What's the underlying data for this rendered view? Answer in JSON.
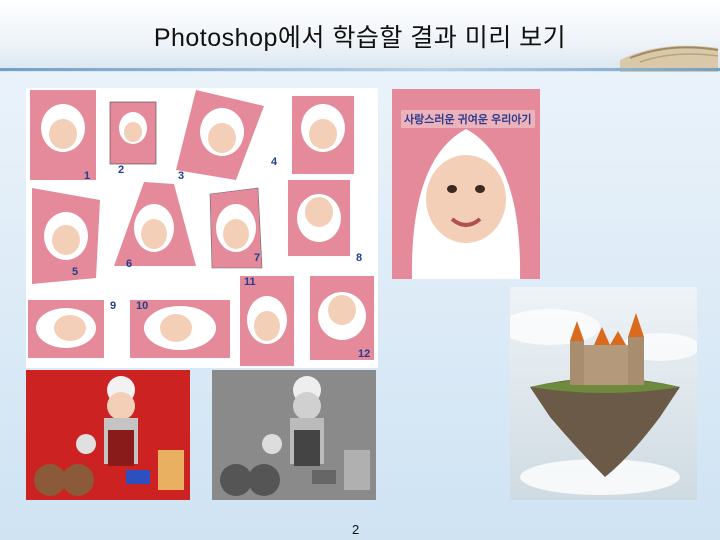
{
  "slide": {
    "title": "Photoshop에서 학습할 결과 미리 보기",
    "page_number": "2"
  },
  "collage": {
    "numbers": [
      "1",
      "2",
      "3",
      "4",
      "5",
      "6",
      "7",
      "8",
      "9",
      "10",
      "11",
      "12"
    ]
  },
  "preview": {
    "caption": "사랑스러운 귀여운 우리아기"
  },
  "colors": {
    "pink_bg": "#e48a9a",
    "red_bg": "#cc2222",
    "sky": "#dfe8ee",
    "header_rule": "#6fa0c8"
  }
}
